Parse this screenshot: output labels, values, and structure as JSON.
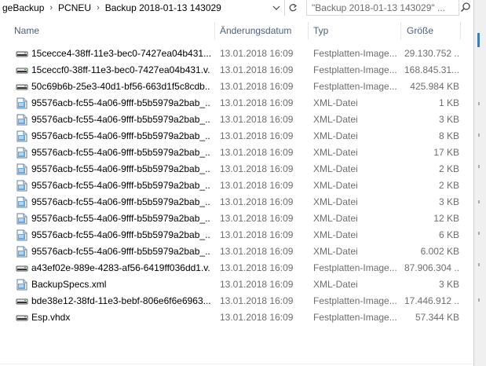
{
  "address": {
    "crumbs": [
      "geBackup",
      "PCNEU",
      "Backup 2018-01-13 143029"
    ],
    "separator": "›"
  },
  "search": {
    "placeholder": "\"Backup 2018-01-13 143029\" ..."
  },
  "columns": {
    "name": "Name",
    "date": "Änderungsdatum",
    "type": "Typ",
    "size": "Größe"
  },
  "files": [
    {
      "name": "15cecce4-38ff-11e3-bec0-7427ea04b431....",
      "date": "13.01.2018 16:09",
      "type": "Festplatten-Image...",
      "size": "29.130.752 ...",
      "icon": "disk-image-icon"
    },
    {
      "name": "15ceccf0-38ff-11e3-bec0-7427ea04b431.v...",
      "date": "13.01.2018 16:09",
      "type": "Festplatten-Image...",
      "size": "168.845.31...",
      "icon": "disk-image-icon"
    },
    {
      "name": "50c69b6b-25e3-40d1-bf56-663d1f5c8cdb....",
      "date": "13.01.2018 16:09",
      "type": "Festplatten-Image...",
      "size": "425.984 KB",
      "icon": "disk-image-icon"
    },
    {
      "name": "95576acb-fc55-4a06-9fff-b5b5979a2bab_...",
      "date": "13.01.2018 16:09",
      "type": "XML-Datei",
      "size": "1 KB",
      "icon": "xml-file-icon"
    },
    {
      "name": "95576acb-fc55-4a06-9fff-b5b5979a2bab_...",
      "date": "13.01.2018 16:09",
      "type": "XML-Datei",
      "size": "3 KB",
      "icon": "xml-file-icon"
    },
    {
      "name": "95576acb-fc55-4a06-9fff-b5b5979a2bab_...",
      "date": "13.01.2018 16:09",
      "type": "XML-Datei",
      "size": "8 KB",
      "icon": "xml-file-icon"
    },
    {
      "name": "95576acb-fc55-4a06-9fff-b5b5979a2bab_...",
      "date": "13.01.2018 16:09",
      "type": "XML-Datei",
      "size": "17 KB",
      "icon": "xml-file-icon"
    },
    {
      "name": "95576acb-fc55-4a06-9fff-b5b5979a2bab_...",
      "date": "13.01.2018 16:09",
      "type": "XML-Datei",
      "size": "2 KB",
      "icon": "xml-file-icon"
    },
    {
      "name": "95576acb-fc55-4a06-9fff-b5b5979a2bab_...",
      "date": "13.01.2018 16:09",
      "type": "XML-Datei",
      "size": "2 KB",
      "icon": "xml-file-icon"
    },
    {
      "name": "95576acb-fc55-4a06-9fff-b5b5979a2bab_...",
      "date": "13.01.2018 16:09",
      "type": "XML-Datei",
      "size": "3 KB",
      "icon": "xml-file-icon"
    },
    {
      "name": "95576acb-fc55-4a06-9fff-b5b5979a2bab_...",
      "date": "13.01.2018 16:09",
      "type": "XML-Datei",
      "size": "12 KB",
      "icon": "xml-file-icon"
    },
    {
      "name": "95576acb-fc55-4a06-9fff-b5b5979a2bab_...",
      "date": "13.01.2018 16:09",
      "type": "XML-Datei",
      "size": "6 KB",
      "icon": "xml-file-icon"
    },
    {
      "name": "95576acb-fc55-4a06-9fff-b5b5979a2bab_...",
      "date": "13.01.2018 16:09",
      "type": "XML-Datei",
      "size": "6.002 KB",
      "icon": "xml-file-icon"
    },
    {
      "name": "a43ef02e-989e-4283-af56-6419ff036dd1.v...",
      "date": "13.01.2018 16:09",
      "type": "Festplatten-Image...",
      "size": "87.906.304 ...",
      "icon": "disk-image-icon"
    },
    {
      "name": "BackupSpecs.xml",
      "date": "13.01.2018 16:09",
      "type": "XML-Datei",
      "size": "3 KB",
      "icon": "xml-file-icon"
    },
    {
      "name": "bde38e12-38fd-11e3-bebf-806e6f6e6963....",
      "date": "13.01.2018 16:09",
      "type": "Festplatten-Image...",
      "size": "17.446.912 ...",
      "icon": "disk-image-icon"
    },
    {
      "name": "Esp.vhdx",
      "date": "13.01.2018 16:09",
      "type": "Festplatten-Image...",
      "size": "57.344 KB",
      "icon": "disk-image-icon"
    }
  ],
  "colors": {
    "header_text": "#4c607a",
    "meta_text": "#6d6d6d",
    "accent": "#3c7fb1"
  }
}
